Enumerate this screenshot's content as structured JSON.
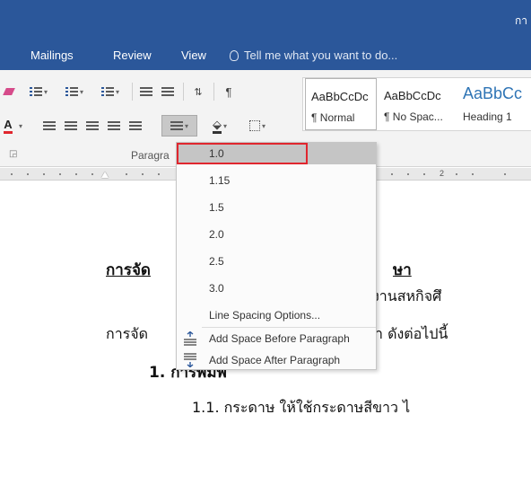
{
  "window": {
    "title_fragment": "กา"
  },
  "ribbon_tabs": [
    "Mailings",
    "Review",
    "View"
  ],
  "tell_me": {
    "placeholder": "Tell me what you want to do..."
  },
  "styles": [
    {
      "sample": "AaBbCcDc",
      "name": "¶ Normal"
    },
    {
      "sample": "AaBbCcDc",
      "name": "¶ No Spac..."
    },
    {
      "sample": "AaBbCc",
      "name": "Heading 1"
    }
  ],
  "paragraph_group_label": "Paragra",
  "ruler": {
    "number": "2"
  },
  "line_spacing_menu": {
    "options": [
      "1.0",
      "1.15",
      "1.5",
      "2.0",
      "2.5",
      "3.0"
    ],
    "selected": "1.0",
    "options_item": "Line Spacing Options...",
    "add_before": "Add Space Before Paragraph",
    "add_after": "Add Space After Paragraph"
  },
  "document": {
    "heading_fragment": "การจัด",
    "heading_fragment_right": "ษา",
    "line2_right": "รายงานสหกิจศึ",
    "line3_left": "การจัด",
    "line3_right": "า ดังต่อไปนี้",
    "item1": "1.  การพิมพ์",
    "item1_1": "1.1. กระดาษ ให้ใช้กระดาษสีขาว ไ"
  },
  "colors": {
    "ribbon_blue": "#2b579a",
    "highlight_red": "#e0262e",
    "heading_blue": "#2e74b5"
  }
}
